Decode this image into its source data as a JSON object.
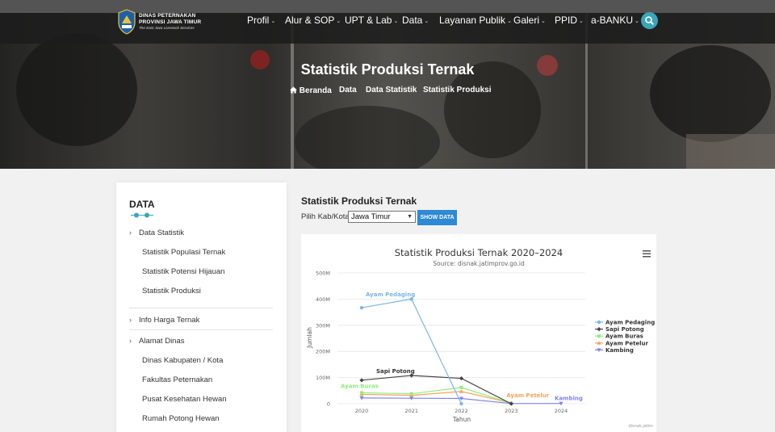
{
  "header": {
    "logo": {
      "line1": "DINAS PETERNAKAN",
      "line2": "PROVINSI JAWA TIMUR",
      "line3": "The East Java Livestock Services"
    },
    "menu": [
      {
        "label": "Profil",
        "caret": "⌄"
      },
      {
        "label": "Alur & SOP",
        "caret": "⌄"
      },
      {
        "label": "UPT & Lab",
        "caret": "⌄"
      },
      {
        "label": "Data",
        "caret": "⌄"
      },
      {
        "label": "Layanan Publik",
        "caret": "⌄"
      },
      {
        "label": "Galeri",
        "caret": "⌄"
      },
      {
        "label": "PPID",
        "caret": "⌄"
      },
      {
        "label": "a-BANKU",
        "caret": "⌄"
      }
    ],
    "icons": {
      "search": "search-icon",
      "home": "home-icon"
    },
    "accent_color": "#3aa6b9"
  },
  "hero": {
    "title": "Statistik Produksi Ternak",
    "breadcrumb": [
      "Beranda",
      "Data",
      "Data Statistik",
      "Statistik Produksi"
    ]
  },
  "sidebar": {
    "heading": "DATA",
    "sections": [
      {
        "label": "Data Statistik",
        "items": [
          "Statistik Populasi Ternak",
          "Statistik Potensi Hijauan",
          "Statistik Produksi"
        ]
      },
      {
        "label": "Info Harga Ternak",
        "items": []
      },
      {
        "label": "Alamat Dinas",
        "items": [
          "Dinas Kabupaten / Kota",
          "Fakultas Peternakan",
          "Pusat Kesehatan Hewan",
          "Rumah Potong Hewan"
        ]
      }
    ]
  },
  "main": {
    "title": "Statistik Produksi Ternak",
    "filter_label": "Pilih Kab/Kota",
    "selected": "Jawa Timur",
    "button_label": "SHOW DATA",
    "button_color": "#2e89d6"
  },
  "chart_data": {
    "type": "line",
    "title": "Statistik Produksi Ternak 2020–2024",
    "subtitle": "Source: disnak.jatimprov.go.id",
    "xlabel": "Tahun",
    "ylabel": "Jumlah",
    "x": [
      2020,
      2021,
      2022,
      2023,
      2024
    ],
    "ylim": [
      0,
      500000000
    ],
    "yticks": [
      0,
      100000000,
      200000000,
      300000000,
      400000000,
      500000000
    ],
    "ytick_labels": [
      "0",
      "100M",
      "200M",
      "300M",
      "400M",
      "500M"
    ],
    "grid": true,
    "legend": "right",
    "credit": "disnak.jatim",
    "menu_icon": "hamburger-icon",
    "series": [
      {
        "name": "Ayam Pedaging",
        "color": "#7cb5ec",
        "marker": "circle",
        "values": [
          367000000,
          400000000,
          0,
          null,
          null
        ]
      },
      {
        "name": "Sapi Potong",
        "color": "#434348",
        "marker": "diamond",
        "values": [
          90000000,
          108000000,
          97000000,
          0,
          null
        ]
      },
      {
        "name": "Ayam Buras",
        "color": "#90ed7d",
        "marker": "square",
        "values": [
          42000000,
          38000000,
          62000000,
          2000000,
          null
        ]
      },
      {
        "name": "Ayam Petelur",
        "color": "#f7a35c",
        "marker": "triangle",
        "values": [
          36000000,
          32000000,
          47000000,
          3000000,
          null
        ]
      },
      {
        "name": "Kambing",
        "color": "#8085e9",
        "marker": "triangle-down",
        "values": [
          22000000,
          21000000,
          20000000,
          1000000,
          1000000
        ]
      }
    ],
    "data_labels": [
      {
        "series": "Ayam Pedaging",
        "text": "Ayam Pedaging"
      },
      {
        "series": "Sapi Potong",
        "text": "Sapi Potong"
      },
      {
        "series": "Ayam Buras",
        "text": "Ayam Buras"
      },
      {
        "series": "Ayam Petelur",
        "text": "Ayam Petelur"
      },
      {
        "series": "Kambing",
        "text": "Kambing"
      }
    ]
  }
}
